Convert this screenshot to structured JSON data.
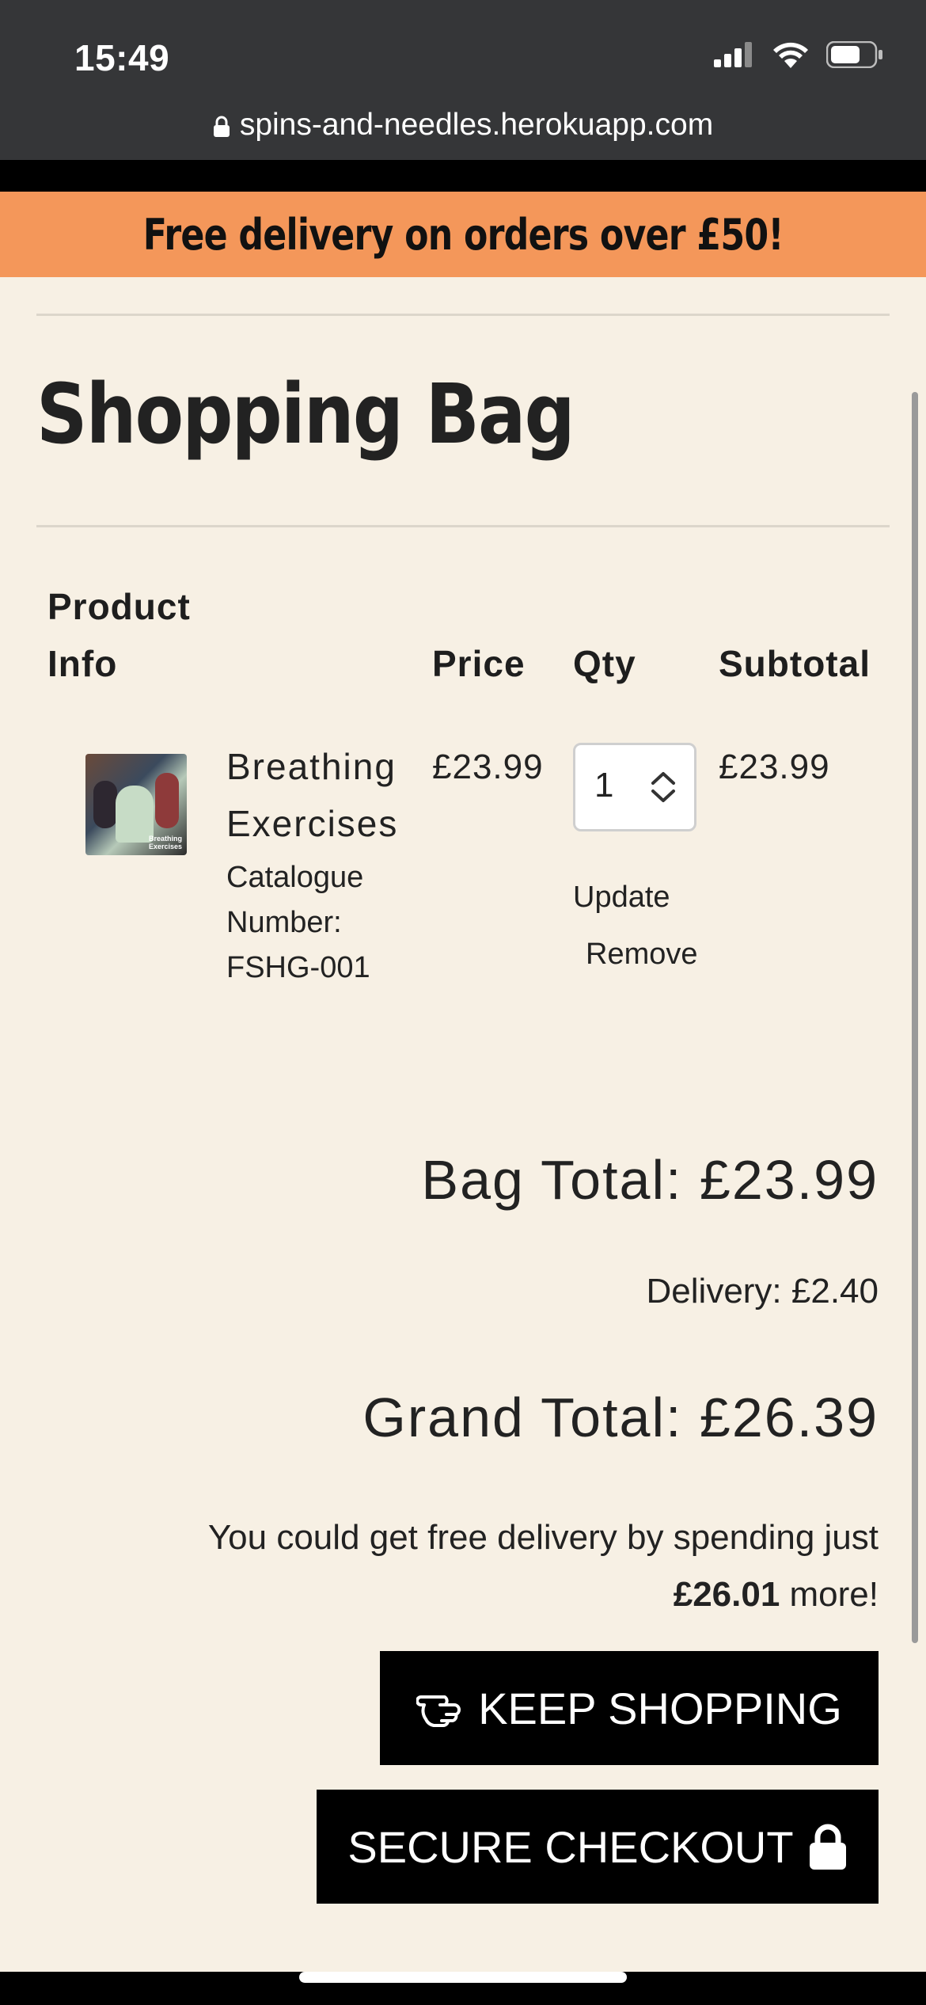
{
  "status_bar": {
    "time": "15:49",
    "icons": [
      "signal-icon",
      "wifi-icon",
      "battery-icon"
    ]
  },
  "browser": {
    "url": "spins-and-needles.herokuapp.com"
  },
  "promo": {
    "text": "Free delivery on orders over £50!"
  },
  "page": {
    "title": "Shopping Bag"
  },
  "table": {
    "headers": {
      "product_info_line1": "Product",
      "product_info_line2": "Info",
      "price": "Price",
      "qty": "Qty",
      "subtotal": "Subtotal"
    },
    "rows": [
      {
        "name_line1": "Breathing",
        "name_line2": "Exercises",
        "catalogue_line1": "Catalogue",
        "catalogue_line2": "Number:",
        "catalogue_line3": "FSHG-001",
        "thumb_caption_line1": "Breathing",
        "thumb_caption_line2": "Exercises",
        "price": "£23.99",
        "qty": "1",
        "subtotal": "£23.99",
        "update_label": "Update",
        "remove_label": "Remove"
      }
    ]
  },
  "totals": {
    "bag_total": "Bag Total: £23.99",
    "delivery": "Delivery: £2.40",
    "grand_total": "Grand Total: £26.39",
    "free_delivery_line1": "You could get free delivery by spending just",
    "free_delivery_amount": "£26.01",
    "free_delivery_suffix": " more!"
  },
  "buttons": {
    "keep_shopping": "KEEP SHOPPING",
    "secure_checkout": "SECURE CHECKOUT"
  },
  "colors": {
    "promo_bg": "#f4975a",
    "page_bg": "#f7f0e4",
    "button_bg": "#000000",
    "browser_bar": "#353638"
  }
}
